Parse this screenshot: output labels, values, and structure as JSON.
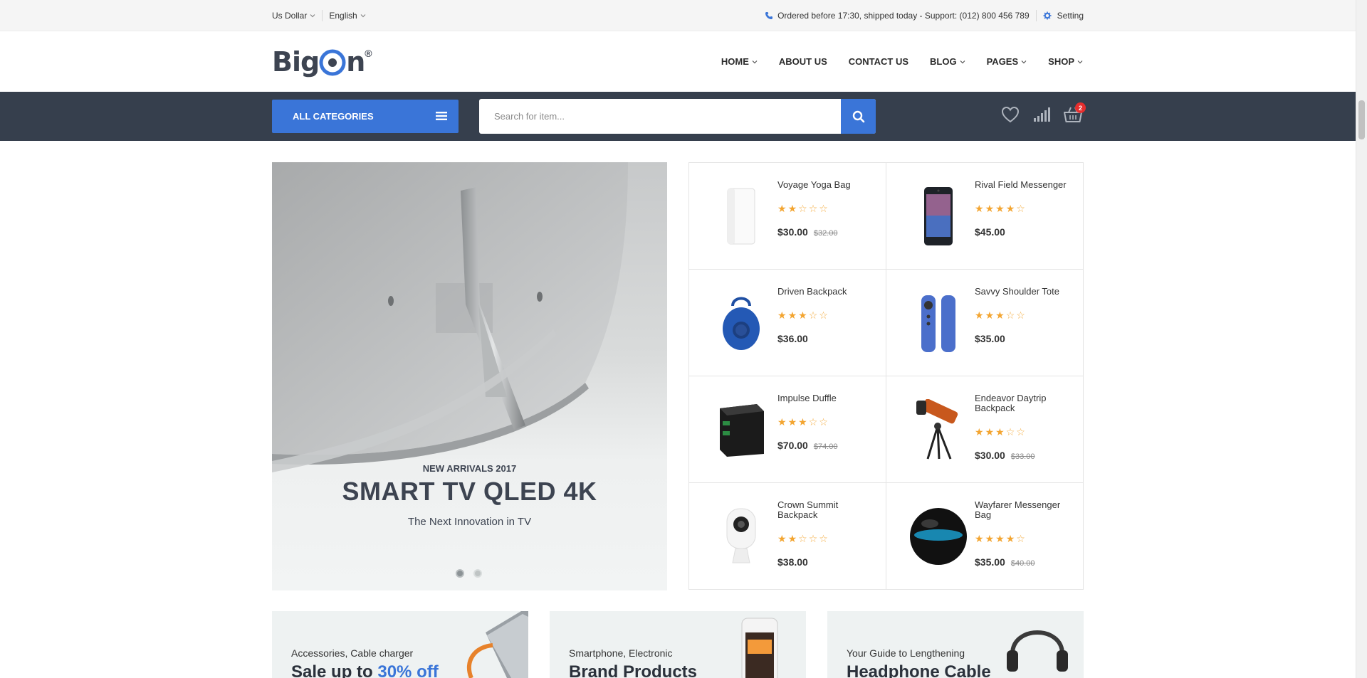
{
  "topbar": {
    "currency": "Us Dollar",
    "language": "English",
    "notice": "Ordered before 17:30, shipped today - Support: (012) 800 456 789",
    "setting": "Setting"
  },
  "header": {
    "logo_text": "Big",
    "logo_o": "n",
    "logo_mark": "®",
    "nav": [
      {
        "label": "HOME",
        "dropdown": true
      },
      {
        "label": "ABOUT US",
        "dropdown": false
      },
      {
        "label": "CONTACT US",
        "dropdown": false
      },
      {
        "label": "BLOG",
        "dropdown": true
      },
      {
        "label": "PAGES",
        "dropdown": true
      },
      {
        "label": "SHOP",
        "dropdown": true
      }
    ]
  },
  "searchbar": {
    "all_categories": "ALL CATEGORIES",
    "placeholder": "Search for item...",
    "cart_count": "2"
  },
  "slider": {
    "subtitle": "NEW ARRIVALS 2017",
    "title": "SMART TV QLED 4K",
    "description": "The Next Innovation in TV",
    "slides": 2,
    "active_slide": 1
  },
  "products": [
    {
      "name": "Voyage Yoga Bag",
      "rating": 2,
      "price": "$30.00",
      "old_price": "$32.00",
      "icon": "power-bank-image"
    },
    {
      "name": "Rival Field Messenger",
      "rating": 4,
      "price": "$45.00",
      "old_price": "",
      "icon": "smartphone-image"
    },
    {
      "name": "Driven Backpack",
      "rating": 3,
      "price": "$36.00",
      "old_price": "",
      "icon": "bluetooth-speaker-image"
    },
    {
      "name": "Savvy Shoulder Tote",
      "rating": 3,
      "price": "$35.00",
      "old_price": "",
      "icon": "remote-control-image"
    },
    {
      "name": "Impulse Duffle",
      "rating": 3,
      "price": "$70.00",
      "old_price": "$74.00",
      "icon": "usb-charger-image"
    },
    {
      "name": "Endeavor Daytrip Backpack",
      "rating": 3,
      "price": "$30.00",
      "old_price": "$33.00",
      "icon": "telescope-image"
    },
    {
      "name": "Crown Summit Backpack",
      "rating": 2,
      "price": "$38.00",
      "old_price": "",
      "icon": "security-camera-image"
    },
    {
      "name": "Wayfarer Messenger Bag",
      "rating": 4,
      "price": "$35.00",
      "old_price": "$40.00",
      "icon": "orb-speaker-image"
    }
  ],
  "banners": [
    {
      "subtitle": "Accessories, Cable charger",
      "title": "Sale up to ",
      "highlight": "30% off"
    },
    {
      "subtitle": "Smartphone, Electronic",
      "title": "Brand Products",
      "highlight": ""
    },
    {
      "subtitle": "Your Guide to Lengthening",
      "title": "Headphone Cable",
      "highlight": ""
    }
  ],
  "colors": {
    "accent": "#3a75d8",
    "strip": "#363f4d",
    "star": "#f3a531",
    "badge": "#e62e2e"
  }
}
